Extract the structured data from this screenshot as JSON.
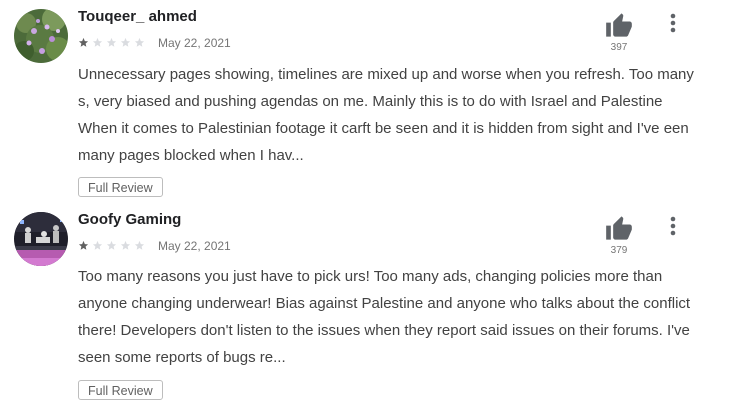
{
  "reviews": [
    {
      "author": "Touqeer_ ahmed",
      "rating": 1,
      "max_rating": 5,
      "date": "May 22, 2021",
      "likes": "397",
      "text": "Unnecessary pages showing, timelines are mixed up and worse when you refresh. Too many\ns, very biased and pushing agendas on me. Mainly this is to do with Israel and Palestine\nWhen it comes to Palestinian footage it carft be seen and it is hidden from sight and I've een\nmany pages blocked when I hav...",
      "full_review_label": "Full Review"
    },
    {
      "author": "Goofy Gaming",
      "rating": 1,
      "max_rating": 5,
      "date": "May 22, 2021",
      "likes": "379",
      "text": "Too many reasons you just have to pick urs! Too many ads, changing policies more than\nanyone changing underwear! Bias against Palestine and anyone who talks about the conflict\nthere! Developers don't listen to the issues when they report said issues on their forums. I've\nseen some reports of bugs re...",
      "full_review_label": "Full Review"
    }
  ],
  "colors": {
    "star_filled": "#616161",
    "star_empty": "#dadce0",
    "icon": "#5f6368",
    "meta_text": "#757575"
  },
  "icons": {
    "like": "thumbs-up-icon",
    "menu": "more-vert-icon",
    "star": "star-icon"
  }
}
